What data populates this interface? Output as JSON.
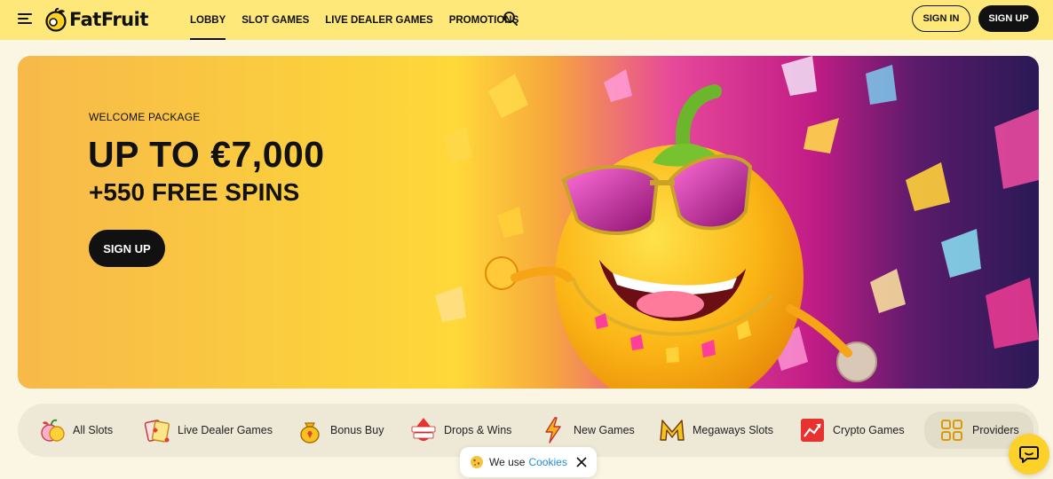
{
  "brand": {
    "name": "FatFruit"
  },
  "nav": {
    "items": [
      {
        "label": "LOBBY",
        "active": true
      },
      {
        "label": "SLOT GAMES"
      },
      {
        "label": "LIVE DEALER GAMES"
      },
      {
        "label": "PROMOTIONS"
      }
    ]
  },
  "auth": {
    "signin": "SIGN IN",
    "signup": "SIGN UP"
  },
  "hero": {
    "kicker": "WELCOME PACKAGE",
    "title": "UP TO €7,000",
    "subtitle": "+550 FREE SPINS",
    "cta": "SIGN UP"
  },
  "categories": [
    {
      "label": "All Slots",
      "icon": "fruit-icon"
    },
    {
      "label": "Live Dealer Games",
      "icon": "cards-icon"
    },
    {
      "label": "Bonus Buy",
      "icon": "money-bag-icon"
    },
    {
      "label": "Drops & Wins",
      "icon": "drops-wins-icon"
    },
    {
      "label": "New Games",
      "icon": "lightning-icon"
    },
    {
      "label": "Megaways Slots",
      "icon": "megaways-icon"
    },
    {
      "label": "Crypto Games",
      "icon": "chart-icon"
    },
    {
      "label": "Providers",
      "icon": "grid-icon"
    }
  ],
  "cookie": {
    "text": "We use",
    "link": "Cookies"
  },
  "colors": {
    "header": "#fde879",
    "accent": "#fcd12a",
    "dark": "#111111",
    "link": "#1d8fd8"
  }
}
